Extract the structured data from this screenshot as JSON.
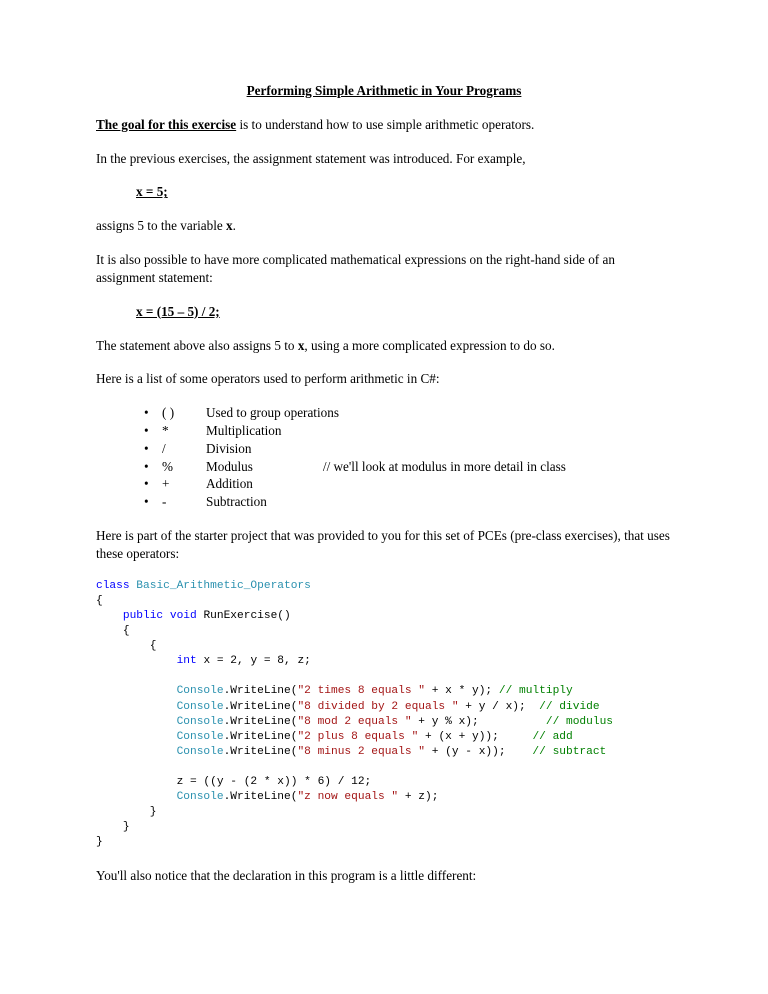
{
  "title": "Performing Simple Arithmetic in Your Programs",
  "p1_goal": "The goal for this exercise",
  "p1_rest": " is to understand how to use simple arithmetic operators.",
  "p2": "In the previous exercises, the assignment statement was introduced.  For example,",
  "expr1": "x = 5;",
  "p3_a": "assigns 5 to the variable ",
  "p3_b": "x",
  "p3_c": ".",
  "p4": "It is also possible to have more complicated mathematical expressions on the right-hand side of an assignment statement:",
  "expr2": "x = (15 – 5) / 2;",
  "p5_a": "The statement above also assigns 5 to ",
  "p5_b": "x",
  "p5_c": ", using a more complicated expression to do so.",
  "p6": "Here is a list of some operators used to perform arithmetic in C#:",
  "operators": [
    {
      "sym": "( )",
      "desc": "Used to group operations",
      "note": ""
    },
    {
      "sym": "*",
      "desc": "Multiplication",
      "note": ""
    },
    {
      "sym": "/",
      "desc": "Division",
      "note": ""
    },
    {
      "sym": "%",
      "desc": "Modulus",
      "note": "// we'll look at modulus in more detail in class"
    },
    {
      "sym": "+",
      "desc": "Addition",
      "note": ""
    },
    {
      "sym": "-",
      "desc": "Subtraction",
      "note": ""
    }
  ],
  "p7": "Here is part of the starter project that was provided to you for this set of PCEs (pre-class exercises), that uses these operators:",
  "code": {
    "kw_class": "class",
    "cls": "Basic_Arithmetic_Operators",
    "lbrace": "{",
    "kw_public": "public",
    "kw_void": "void",
    "method": "RunExercise()",
    "kw_int": "int",
    "decl": " x = 2, y = 8, z;",
    "console": "Console",
    "wl": ".WriteLine(",
    "s1": "\"2 times 8 equals \"",
    "t1": " + x * y); ",
    "c1": "// multiply",
    "s2": "\"8 divided by 2 equals \"",
    "t2": " + y / x);  ",
    "c2": "// divide",
    "s3": "\"8 mod 2 equals \"",
    "t3": " + y % x);          ",
    "c3": "// modulus",
    "s4": "\"2 plus 8 equals \"",
    "t4": " + (x + y));     ",
    "c4": "// add",
    "s5": "\"8 minus 2 equals \"",
    "t5": " + (y - x));    ",
    "c5": "// subtract",
    "zline": "z = ((y - (2 * x)) * 6) / 12;",
    "s6": "\"z now equals \"",
    "t6": " + z);",
    "rbrace": "}"
  },
  "p8": "You'll also notice that the declaration in this program is a little different:"
}
